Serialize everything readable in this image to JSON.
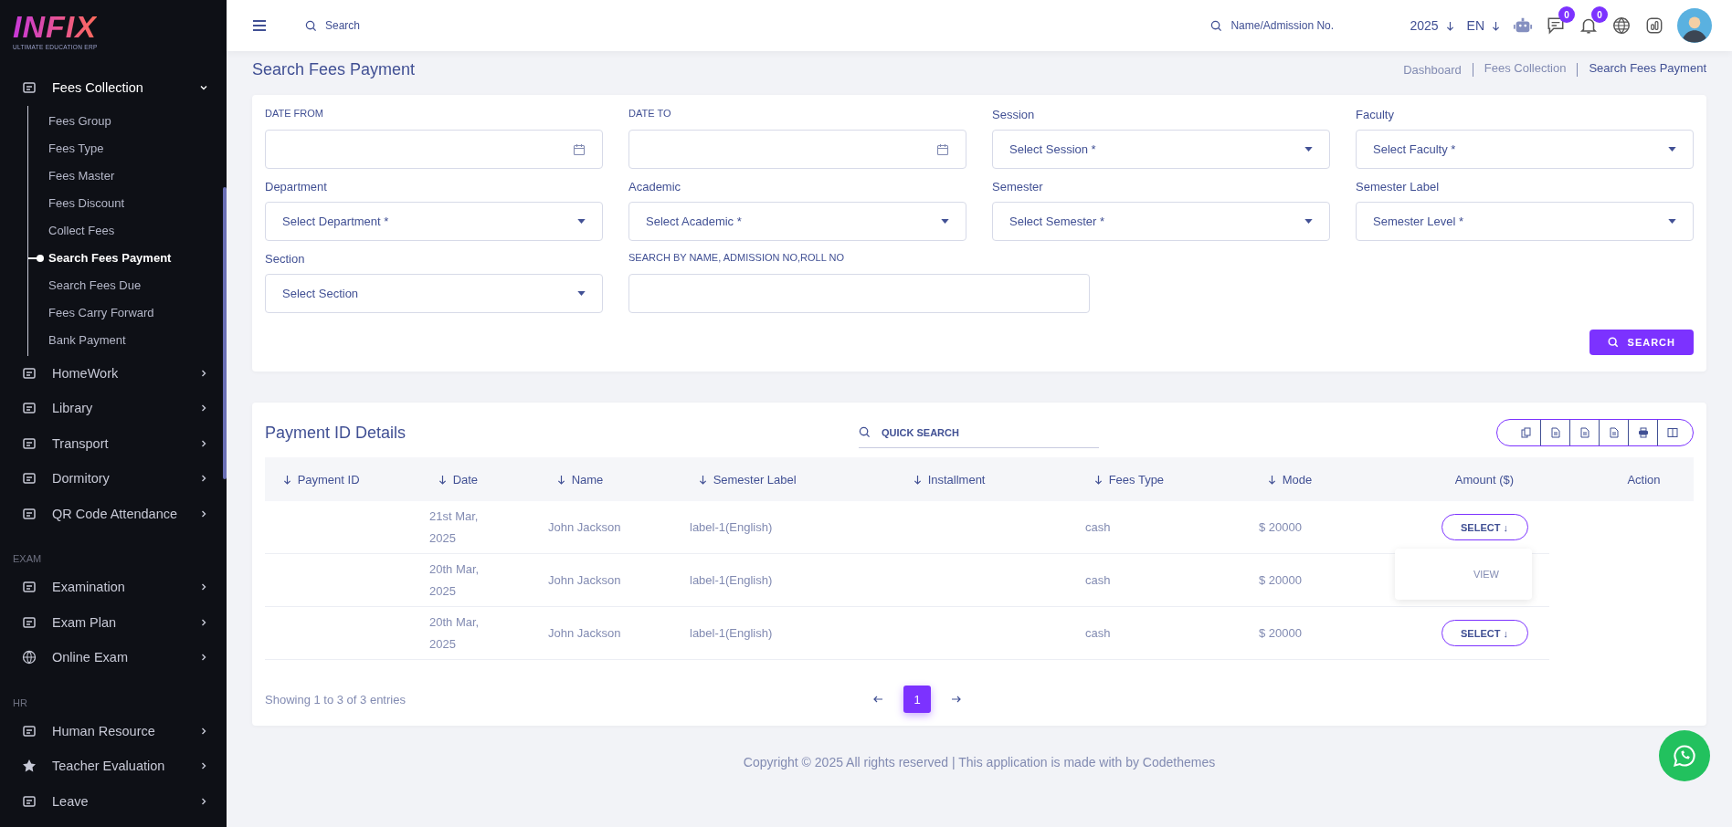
{
  "sidebar": {
    "logo": "INFIX",
    "tagline": "ULTIMATE EDUCATION ERP",
    "sections": [
      {
        "items": [
          {
            "label": "Fees Collection",
            "expanded": true,
            "children": [
              {
                "label": "Fees Group",
                "selected": false
              },
              {
                "label": "Fees Type",
                "selected": false
              },
              {
                "label": "Fees Master",
                "selected": false
              },
              {
                "label": "Fees Discount",
                "selected": false
              },
              {
                "label": "Collect Fees",
                "selected": false
              },
              {
                "label": "Search Fees Payment",
                "selected": true
              },
              {
                "label": "Search Fees Due",
                "selected": false
              },
              {
                "label": "Fees Carry Forward",
                "selected": false
              },
              {
                "label": "Bank Payment",
                "selected": false
              }
            ]
          },
          {
            "label": "HomeWork",
            "expanded": false
          },
          {
            "label": "Library",
            "expanded": false
          },
          {
            "label": "Transport",
            "expanded": false
          },
          {
            "label": "Dormitory",
            "expanded": false
          },
          {
            "label": "QR Code Attendance",
            "expanded": false
          }
        ]
      },
      {
        "heading": "EXAM",
        "items": [
          {
            "label": "Examination",
            "expanded": false
          },
          {
            "label": "Exam Plan",
            "expanded": false
          },
          {
            "label": "Online Exam",
            "expanded": false
          }
        ]
      },
      {
        "heading": "HR",
        "items": [
          {
            "label": "Human Resource",
            "expanded": false
          },
          {
            "label": "Teacher Evaluation",
            "expanded": false
          },
          {
            "label": "Leave",
            "expanded": false
          }
        ]
      }
    ]
  },
  "topbar": {
    "search": {
      "placeholder": "Search"
    },
    "lookup": {
      "placeholder": "Name/Admission No."
    },
    "year": "2025",
    "language": "EN",
    "chat_count": "0",
    "notification_count": "0"
  },
  "page": {
    "title": "Search Fees Payment",
    "breadcrumb": [
      "Dashboard",
      "Fees Collection",
      "Search Fees Payment"
    ]
  },
  "filters": {
    "fields": [
      {
        "kind": "date",
        "label": "DATE FROM"
      },
      {
        "kind": "date",
        "label": "DATE TO"
      },
      {
        "kind": "select",
        "label": "Session",
        "value": "Select Session *"
      },
      {
        "kind": "select",
        "label": "Faculty",
        "value": "Select Faculty *"
      },
      {
        "kind": "select",
        "label": "Department",
        "value": "Select Department *"
      },
      {
        "kind": "select",
        "label": "Academic",
        "value": "Select Academic *"
      },
      {
        "kind": "select",
        "label": "Semester",
        "value": "Select Semester *"
      },
      {
        "kind": "select",
        "label": "Semester Label",
        "value": "Semester Level *"
      },
      {
        "kind": "select",
        "label": "Section",
        "value": "Select Section"
      },
      {
        "kind": "text",
        "label": "SEARCH BY NAME, ADMISSION NO,ROLL NO"
      }
    ],
    "search_button": "SEARCH"
  },
  "table": {
    "title": "Payment ID Details",
    "quick_search": {
      "placeholder": "QUICK SEARCH"
    },
    "columns": [
      {
        "label": "Payment ID",
        "sortable": true
      },
      {
        "label": "Date",
        "sortable": true
      },
      {
        "label": "Name",
        "sortable": true
      },
      {
        "label": "Semester Label",
        "sortable": true
      },
      {
        "label": "Installment",
        "sortable": true
      },
      {
        "label": "Fees Type",
        "sortable": true
      },
      {
        "label": "Mode",
        "sortable": true
      },
      {
        "label": "Amount ($)",
        "sortable": false
      },
      {
        "label": "Action",
        "sortable": false
      }
    ],
    "rows": [
      {
        "date": "21st Mar, 2025",
        "name": "John Jackson",
        "semester_label": "label-1(English)",
        "fees_type": "cash",
        "mode": "$ 20000",
        "action": "SELECT ↓",
        "menu": [
          "VIEW"
        ]
      },
      {
        "date": "20th Mar, 2025",
        "name": "John Jackson",
        "semester_label": "label-1(English)",
        "fees_type": "cash",
        "mode": "$ 20000"
      },
      {
        "date": "20th Mar, 2025",
        "name": "John Jackson",
        "semester_label": "label-1(English)",
        "fees_type": "cash",
        "mode": "$ 20000",
        "action": "SELECT ↓"
      }
    ],
    "summary": "Showing 1 to 3 of 3 entries",
    "pages": [
      {
        "label": "1",
        "selected": true
      }
    ]
  },
  "footer": "Copyright © 2025 All rights reserved | This application is made with by Codethemes"
}
